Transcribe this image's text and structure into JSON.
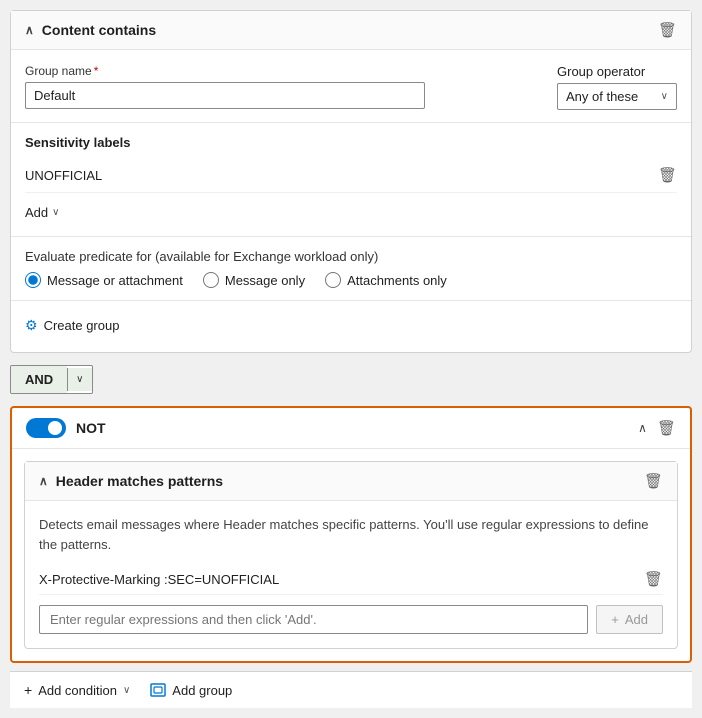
{
  "content_contains": {
    "title": "Content contains",
    "group_name_label": "Group name",
    "group_name_required": true,
    "group_name_value": "Default",
    "group_operator_label": "Group operator",
    "group_operator_value": "Any of these",
    "sensitivity_labels_title": "Sensitivity labels",
    "sensitivity_items": [
      {
        "label": "UNOFFICIAL"
      }
    ],
    "add_label": "Add",
    "evaluate_label": "Evaluate predicate for (available for Exchange workload only)",
    "radio_options": [
      {
        "id": "msg_or_attach",
        "label": "Message or attachment",
        "checked": true
      },
      {
        "id": "msg_only",
        "label": "Message only",
        "checked": false
      },
      {
        "id": "attach_only",
        "label": "Attachments only",
        "checked": false
      }
    ],
    "create_group_label": "Create group"
  },
  "and_button": {
    "label": "AND"
  },
  "not_section": {
    "toggle_on": true,
    "label": "NOT"
  },
  "header_matches": {
    "title": "Header matches patterns",
    "description": "Detects email messages where Header matches specific patterns. You'll use regular expressions to define the patterns.",
    "pattern_items": [
      {
        "label": "X-Protective-Marking :SEC=UNOFFICIAL"
      }
    ],
    "input_placeholder": "Enter regular expressions and then click 'Add'.",
    "add_button_label": "Add"
  },
  "bottom_bar": {
    "add_condition_label": "Add condition",
    "add_group_label": "Add group"
  },
  "icons": {
    "chevron_up": "∧",
    "chevron_down": "∨",
    "delete": "🗑",
    "plus": "+",
    "people": "⚙"
  }
}
